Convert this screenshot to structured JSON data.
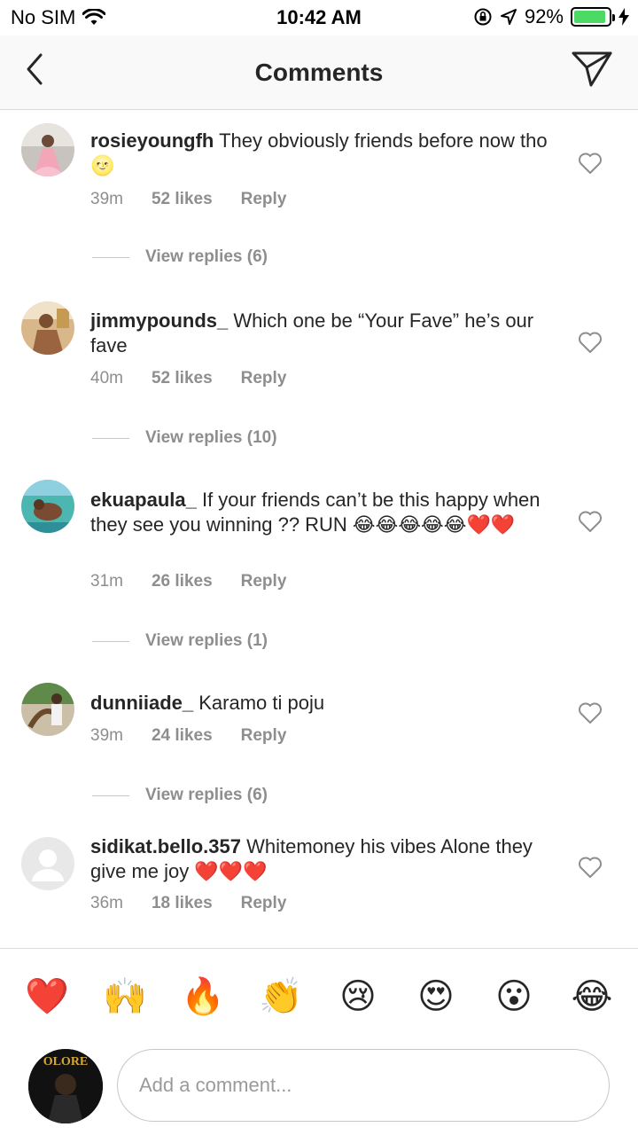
{
  "status_bar": {
    "carrier": "No SIM",
    "time": "10:42 AM",
    "battery_text": "92%",
    "battery_level": 0.92,
    "battery_color": "#4cd964"
  },
  "nav": {
    "title": "Comments",
    "back_icon": "chevron-left-icon",
    "share_icon": "paper-plane-icon"
  },
  "comments": [
    {
      "username": "rosieyoungfh",
      "text": "They obviously friends before now tho 🌝",
      "time": "39m",
      "likes": "52 likes",
      "reply": "Reply",
      "view_replies": "View replies (6)"
    },
    {
      "username": "jimmypounds_",
      "text": "Which one be “Your Fave” he’s our fave",
      "time": "40m",
      "likes": "52 likes",
      "reply": "Reply",
      "view_replies": "View replies (10)"
    },
    {
      "username": "ekuapaula_",
      "text": "If your friends can’t be this happy when they see you winning ?? RUN 😂😂😂😂😂❤️❤️",
      "time": "31m",
      "likes": "26 likes",
      "reply": "Reply",
      "view_replies": "View replies (1)"
    },
    {
      "username": "dunniiade_",
      "text": "Karamo ti poju",
      "time": "39m",
      "likes": "24 likes",
      "reply": "Reply",
      "view_replies": "View replies (6)"
    },
    {
      "username": "sidikat.bello.357",
      "text": "Whitemoney his vibes Alone they give me  joy ❤️❤️❤️",
      "time": "36m",
      "likes": "18 likes",
      "reply": "Reply"
    }
  ],
  "emoji_bar": [
    "❤️",
    "🙌",
    "🔥",
    "👏",
    "😢",
    "😍",
    "😮",
    "😂"
  ],
  "composer": {
    "placeholder": "Add a comment...",
    "avatar_text": "OLORE"
  }
}
